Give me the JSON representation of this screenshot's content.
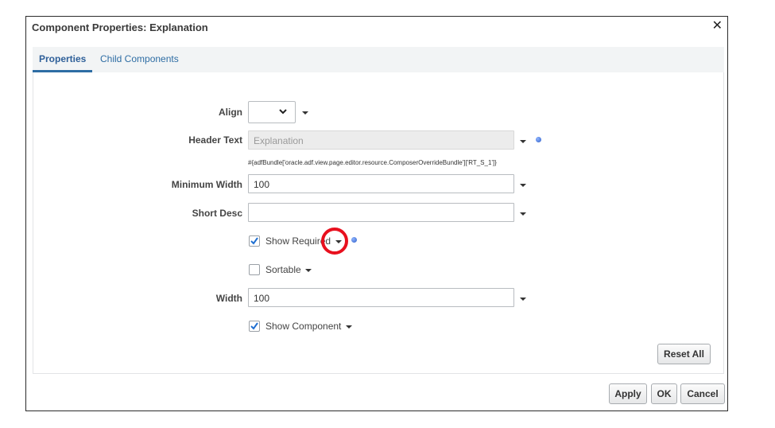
{
  "dialog": {
    "title": "Component Properties: Explanation",
    "close_label": "✕"
  },
  "tabs": [
    {
      "label": "Properties",
      "active": true
    },
    {
      "label": "Child Components",
      "active": false
    }
  ],
  "form": {
    "align": {
      "label": "Align",
      "value": ""
    },
    "header_text": {
      "label": "Header Text",
      "value": "Explanation",
      "el_expression": "#{adfBundle['oracle.adf.view.page.editor.resource.ComposerOverrideBundle']['RT_S_1']}"
    },
    "minimum_width": {
      "label": "Minimum Width",
      "value": "100"
    },
    "short_desc": {
      "label": "Short Desc",
      "value": ""
    },
    "show_required": {
      "label": "Show Required",
      "checked": true
    },
    "sortable": {
      "label": "Sortable",
      "checked": false
    },
    "width": {
      "label": "Width",
      "value": "100"
    },
    "show_component": {
      "label": "Show Component",
      "checked": true
    }
  },
  "buttons": {
    "reset_all": "Reset All",
    "apply": "Apply",
    "ok": "OK",
    "cancel": "Cancel"
  },
  "colors": {
    "accent": "#2e6da4",
    "highlight_circle": "#e8101e",
    "check": "#1f6fd1"
  }
}
